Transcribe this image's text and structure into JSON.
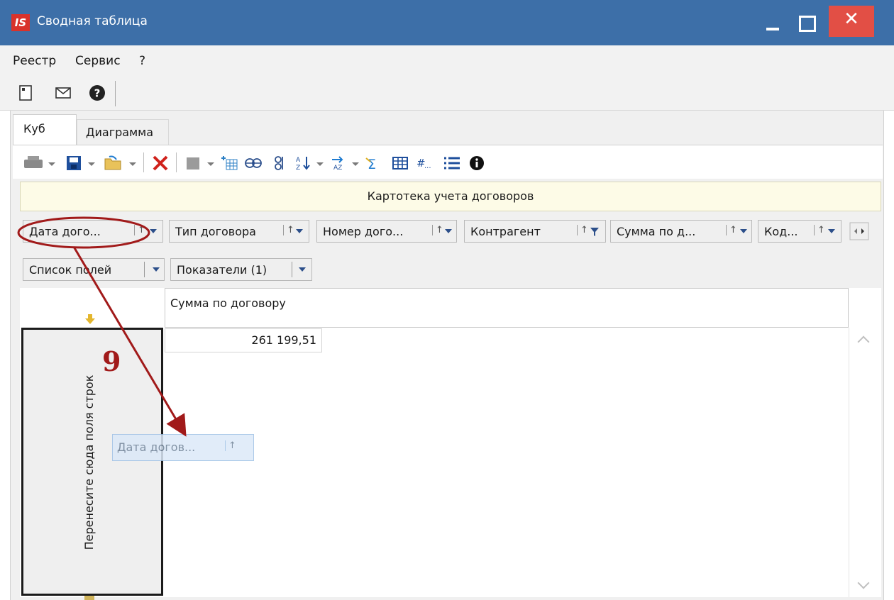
{
  "window": {
    "app_logo": "IS",
    "title": "Сводная таблица",
    "close_symbol": "✕"
  },
  "menu": [
    "Реестр",
    "Сервис",
    "?"
  ],
  "tabs": [
    "Куб",
    "Диаграмма"
  ],
  "caption": "Картотека учета договоров",
  "filter_fields": [
    {
      "label": "Дата дого...",
      "sort": "↑"
    },
    {
      "label": "Тип договора",
      "sort": "↑"
    },
    {
      "label": "Номер дого...",
      "sort": "↑"
    },
    {
      "label": "Контрагент",
      "sort": "↑"
    },
    {
      "label": "Сумма по д...",
      "sort": "↑"
    },
    {
      "label": "Код...",
      "sort": "↑"
    }
  ],
  "row2": {
    "field_list": "Список полей",
    "measures": "Показатели (1)"
  },
  "grid": {
    "column_header": "Сумма по договору",
    "value": "261 199,51"
  },
  "drop_zone_text": "Перенесите сюда поля строк",
  "drag_ghost": {
    "label": "Дата догов...",
    "sort": "↑"
  },
  "annotation": {
    "step": "9",
    "color": "#a11a1a"
  },
  "colors": {
    "titlebar": "#3d6fa8",
    "close": "#e24f45",
    "accent_blue": "#1e4f9c"
  }
}
